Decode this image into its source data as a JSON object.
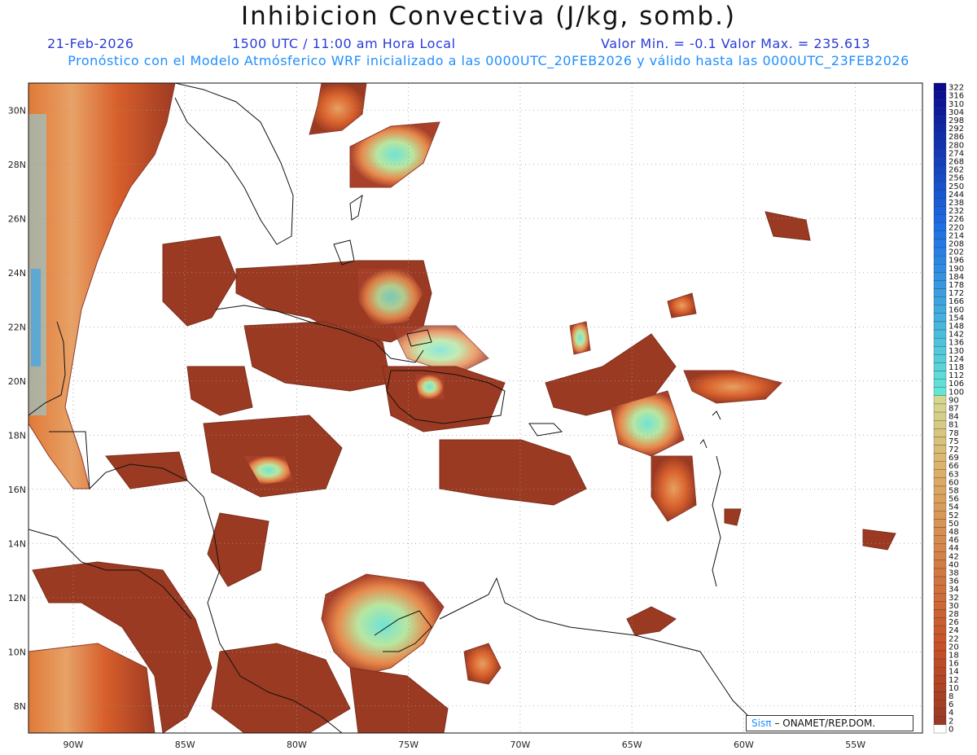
{
  "header": {
    "title": "Inhibicion Convectiva (J/kg, somb.)",
    "date": "21-Feb-2026",
    "time": "1500 UTC / 11:00 am Hora Local",
    "min_max": "Valor Min. = -0.1  Valor Max. = 235.613",
    "model_info": "Pronóstico con el Modelo Atmósferico WRF inicializado a las 0000UTC_20FEB2026 y válido hasta las  0000UTC_23FEB2026"
  },
  "map": {
    "lon_labels": [
      "90W",
      "85W",
      "80W",
      "75W",
      "70W",
      "65W",
      "60W",
      "55W"
    ],
    "lat_labels": [
      "30N",
      "28N",
      "26N",
      "24N",
      "22N",
      "20N",
      "18N",
      "16N",
      "14N",
      "12N",
      "10N",
      "8N"
    ],
    "lon_range": [
      -92,
      -52
    ],
    "lat_range": [
      7,
      31
    ]
  },
  "colorbar": {
    "levels": [
      "322",
      "316",
      "310",
      "304",
      "298",
      "292",
      "286",
      "280",
      "274",
      "268",
      "262",
      "256",
      "250",
      "244",
      "238",
      "232",
      "226",
      "220",
      "214",
      "208",
      "202",
      "196",
      "190",
      "184",
      "178",
      "172",
      "166",
      "160",
      "154",
      "148",
      "142",
      "136",
      "130",
      "124",
      "118",
      "112",
      "106",
      "100",
      "90",
      "87",
      "84",
      "81",
      "78",
      "75",
      "72",
      "69",
      "66",
      "63",
      "60",
      "58",
      "56",
      "54",
      "52",
      "50",
      "48",
      "46",
      "44",
      "42",
      "40",
      "38",
      "36",
      "34",
      "32",
      "30",
      "28",
      "26",
      "24",
      "22",
      "20",
      "18",
      "16",
      "14",
      "12",
      "10",
      "8",
      "6",
      "4",
      "2",
      "0"
    ]
  },
  "credit": {
    "logo": "Sisπ",
    "text": "– ONAMET/REP.DOM."
  }
}
